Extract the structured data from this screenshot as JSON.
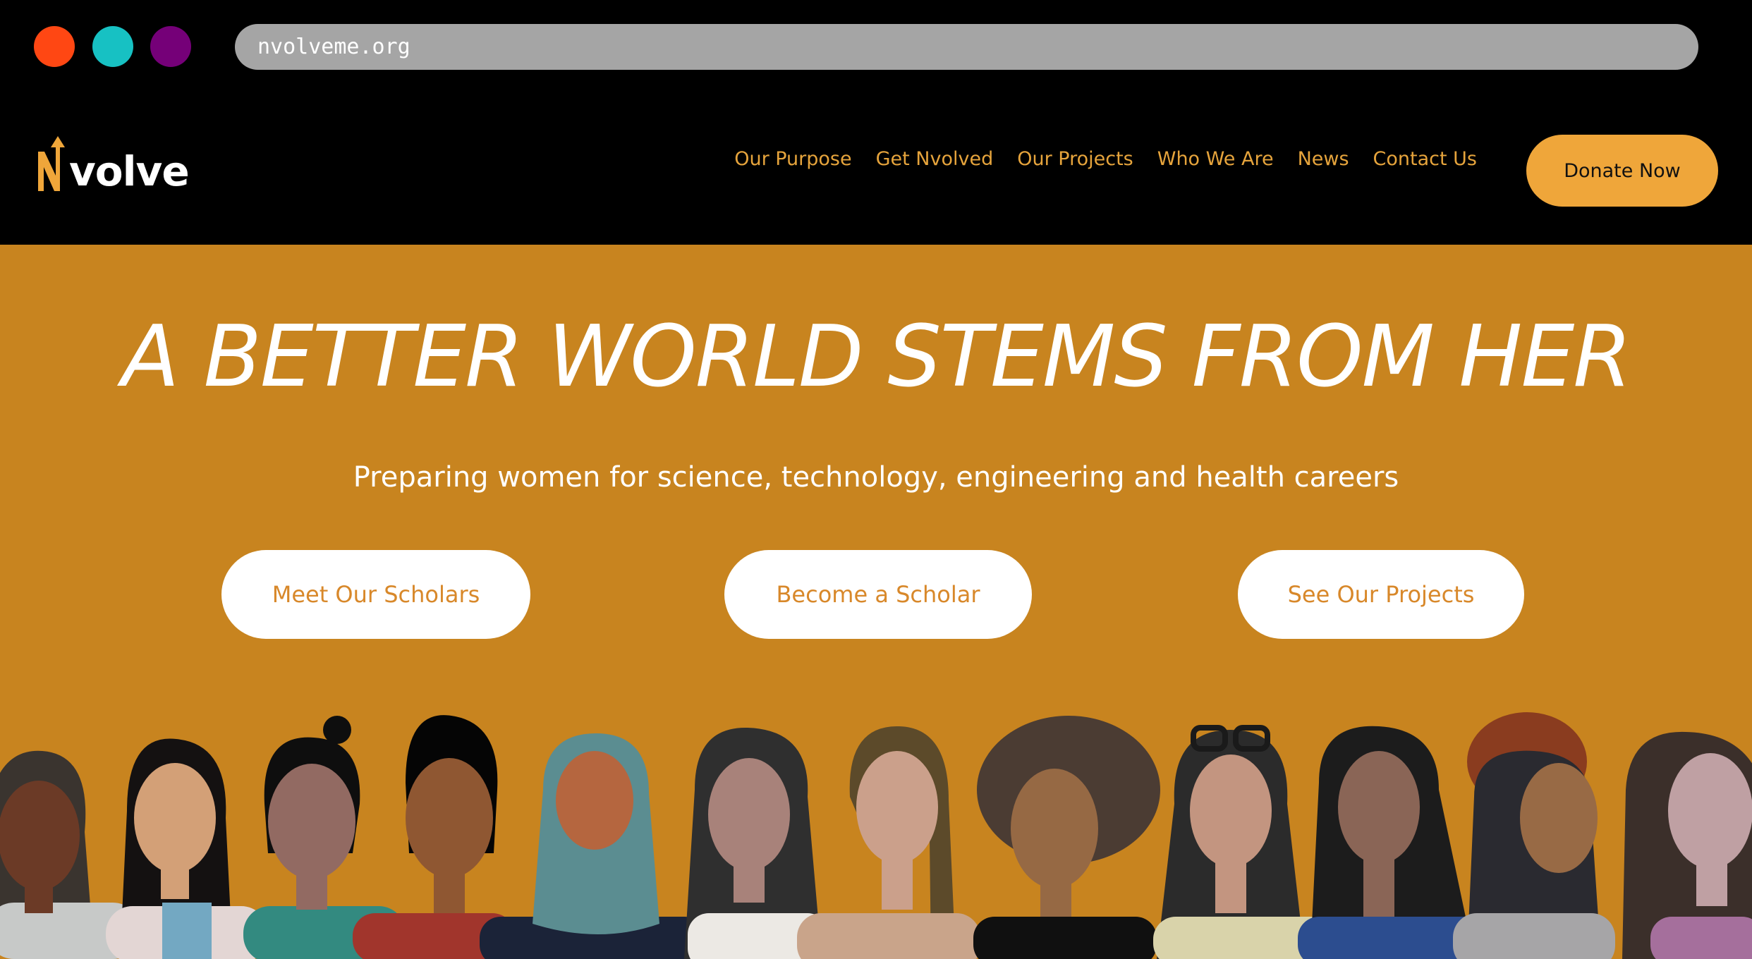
{
  "browser": {
    "url": "nvolveme.org",
    "window_controls": [
      {
        "name": "close-dot",
        "color": "#ff4713"
      },
      {
        "name": "minimize-dot",
        "color": "#17c1c3"
      },
      {
        "name": "maximize-dot",
        "color": "#750078"
      }
    ]
  },
  "header": {
    "logo_text": "volve",
    "logo_letter": "N",
    "nav": [
      "Our Purpose",
      "Get Nvolved",
      "Our Projects",
      "Who We Are",
      "News",
      "Contact Us"
    ],
    "donate_label": "Donate Now"
  },
  "hero": {
    "headline": "A BETTER WORLD STEMS FROM HER",
    "subheadline": "Preparing women for science, technology, engineering and health careers",
    "buttons": [
      "Meet Our Scholars",
      "Become a Scholar",
      "See Our Projects"
    ],
    "illustration": "diverse-women-illustration"
  },
  "colors": {
    "accent": "#efa63a",
    "hero_background": "#c8841f",
    "nav_text": "#e6a43c",
    "button_text": "#d8882a"
  }
}
